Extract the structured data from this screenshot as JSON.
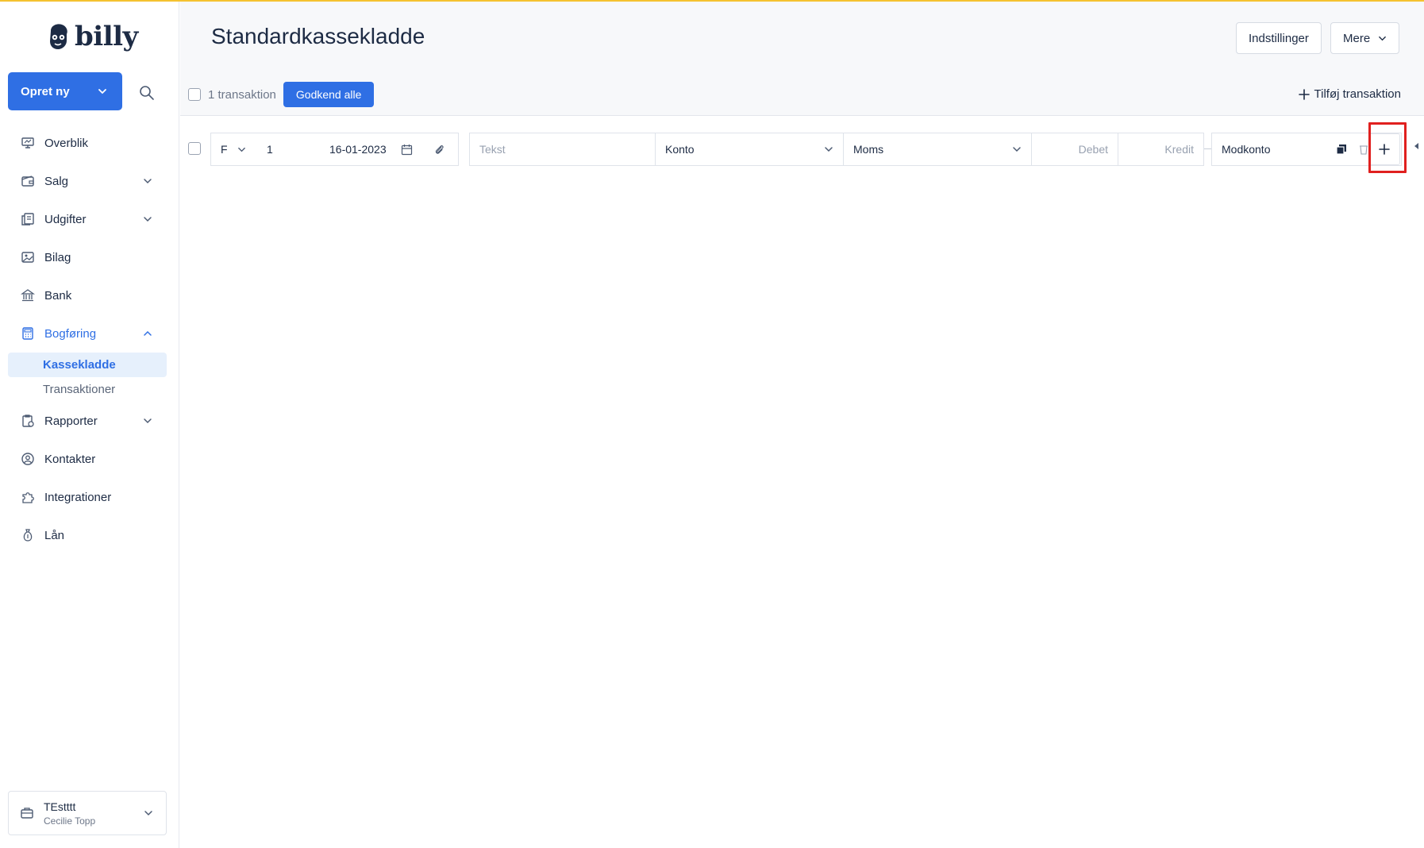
{
  "brand": {
    "logo_text": "billy",
    "accent": "#2f6fe4",
    "top_stripe": "#f5c230"
  },
  "sidebar": {
    "create_label": "Opret ny",
    "search_icon": "search-icon",
    "items": [
      {
        "label": "Overblik",
        "icon": "dashboard-icon"
      },
      {
        "label": "Salg",
        "icon": "wallet-icon",
        "expandable": true
      },
      {
        "label": "Udgifter",
        "icon": "receipts-icon",
        "expandable": true
      },
      {
        "label": "Bilag",
        "icon": "image-icon"
      },
      {
        "label": "Bank",
        "icon": "bank-icon"
      },
      {
        "label": "Bogføring",
        "icon": "calculator-icon",
        "expandable": true,
        "expanded": true,
        "active": true,
        "children": [
          {
            "label": "Kassekladde",
            "selected": true
          },
          {
            "label": "Transaktioner"
          }
        ]
      },
      {
        "label": "Rapporter",
        "icon": "report-icon",
        "expandable": true
      },
      {
        "label": "Kontakter",
        "icon": "contact-icon"
      },
      {
        "label": "Integrationer",
        "icon": "puzzle-icon"
      },
      {
        "label": "Lån",
        "icon": "moneybag-icon"
      }
    ],
    "org": {
      "name": "TEstttt",
      "user": "Cecilie Topp"
    }
  },
  "header": {
    "title": "Standardkassekladde",
    "settings_label": "Indstillinger",
    "more_label": "Mere"
  },
  "toolbar": {
    "count_label": "1 transaktion",
    "approve_label": "Godkend alle",
    "add_label": "Tilføj transaktion"
  },
  "row": {
    "type": "F",
    "number": "1",
    "date": "16-01-2023",
    "text_placeholder": "Tekst",
    "konto": "Konto",
    "moms": "Moms",
    "debet_placeholder": "Debet",
    "kredit_placeholder": "Kredit",
    "modkonto": "Modkonto"
  }
}
